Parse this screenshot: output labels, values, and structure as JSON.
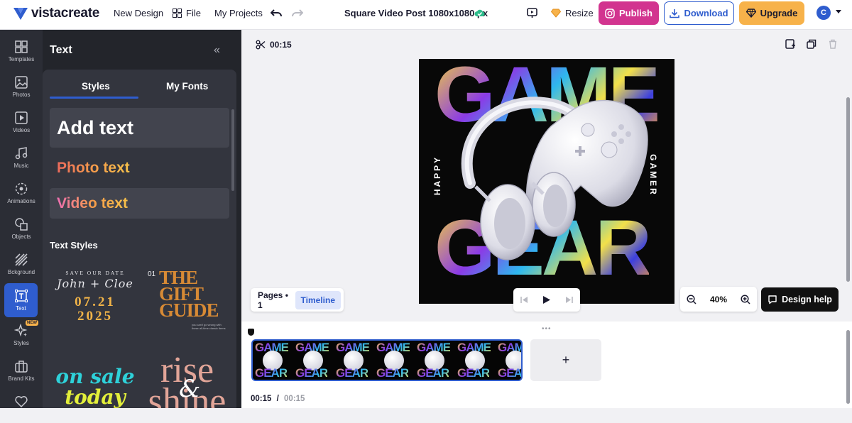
{
  "header": {
    "logo": "vistacreate",
    "new_design": "New Design",
    "file": "File",
    "my_projects": "My Projects",
    "doc_title": "Square Video Post 1080x1080 px",
    "resize": "Resize",
    "publish": "Publish",
    "download": "Download",
    "upgrade": "Upgrade",
    "avatar_initial": "C"
  },
  "rail": {
    "items": [
      {
        "label": "Templates",
        "icon": "templates-icon"
      },
      {
        "label": "Photos",
        "icon": "photos-icon"
      },
      {
        "label": "Videos",
        "icon": "videos-icon"
      },
      {
        "label": "Music",
        "icon": "music-icon"
      },
      {
        "label": "Animations",
        "icon": "animations-icon"
      },
      {
        "label": "Objects",
        "icon": "objects-icon"
      },
      {
        "label": "Bckground",
        "icon": "background-icon"
      },
      {
        "label": "Text",
        "icon": "text-icon",
        "active": true
      },
      {
        "label": "Styles",
        "icon": "styles-icon",
        "badge": "NEW"
      },
      {
        "label": "Brand Kits",
        "icon": "brand-kits-icon"
      },
      {
        "label": "",
        "icon": "heart-icon"
      }
    ]
  },
  "panel": {
    "title": "Text",
    "tabs": [
      "Styles",
      "My Fonts"
    ],
    "add_text": "Add text",
    "photo_text": "Photo text",
    "video_text": "Video text",
    "text_styles_title": "Text Styles",
    "style1": {
      "line1": "SAVE OUR DATE",
      "line2": "John + Cloe",
      "line3": "07.21",
      "line4": "2025"
    },
    "style2": {
      "num": "01",
      "line1": "THE",
      "line2": "GIFT",
      "line3": "GUIDE",
      "small": "you can't go wrong with these all-time classic items"
    },
    "style3": {
      "line1": "on sale",
      "line2": "today"
    },
    "style4": {
      "line1": "rise",
      "amp": "&",
      "line2": "shine"
    }
  },
  "workarea": {
    "duration": "00:15",
    "artboard": {
      "word_top": "GAME",
      "word_bottom": "GEAR",
      "side_left": "HAPPY",
      "side_right": "GAMER"
    },
    "pages_label": "Pages • 1",
    "timeline_label": "Timeline",
    "zoom": "40%",
    "design_help": "Design help"
  },
  "timeline": {
    "frame_top": "GAME",
    "frame_bottom": "GEAR",
    "add": "+",
    "current_time": "00:15",
    "separator": "/",
    "total_time": "00:15"
  }
}
